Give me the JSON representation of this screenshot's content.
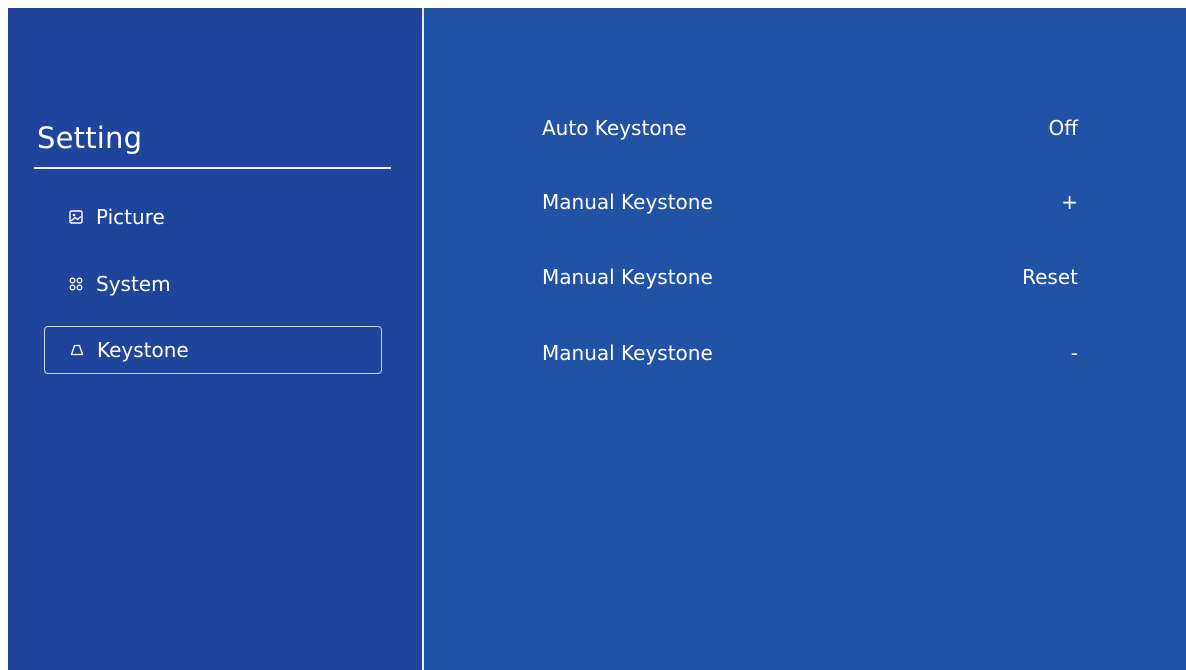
{
  "sidebar": {
    "title": "Setting",
    "items": [
      {
        "label": "Picture",
        "icon": "picture-icon",
        "selected": false
      },
      {
        "label": "System",
        "icon": "apps-grid-icon",
        "selected": false
      },
      {
        "label": "Keystone",
        "icon": "keystone-trapezoid-icon",
        "selected": true
      }
    ]
  },
  "settings": {
    "rows": [
      {
        "label": "Auto Keystone",
        "value": "Off"
      },
      {
        "label": "Manual Keystone",
        "value": "+"
      },
      {
        "label": "Manual Keystone",
        "value": "Reset"
      },
      {
        "label": "Manual Keystone",
        "value": "-"
      }
    ]
  },
  "colors": {
    "sidebar_bg": "#1f449b",
    "content_bg": "#2152a5",
    "text": "#ffffff",
    "accent_line": "#f3f5fa"
  }
}
